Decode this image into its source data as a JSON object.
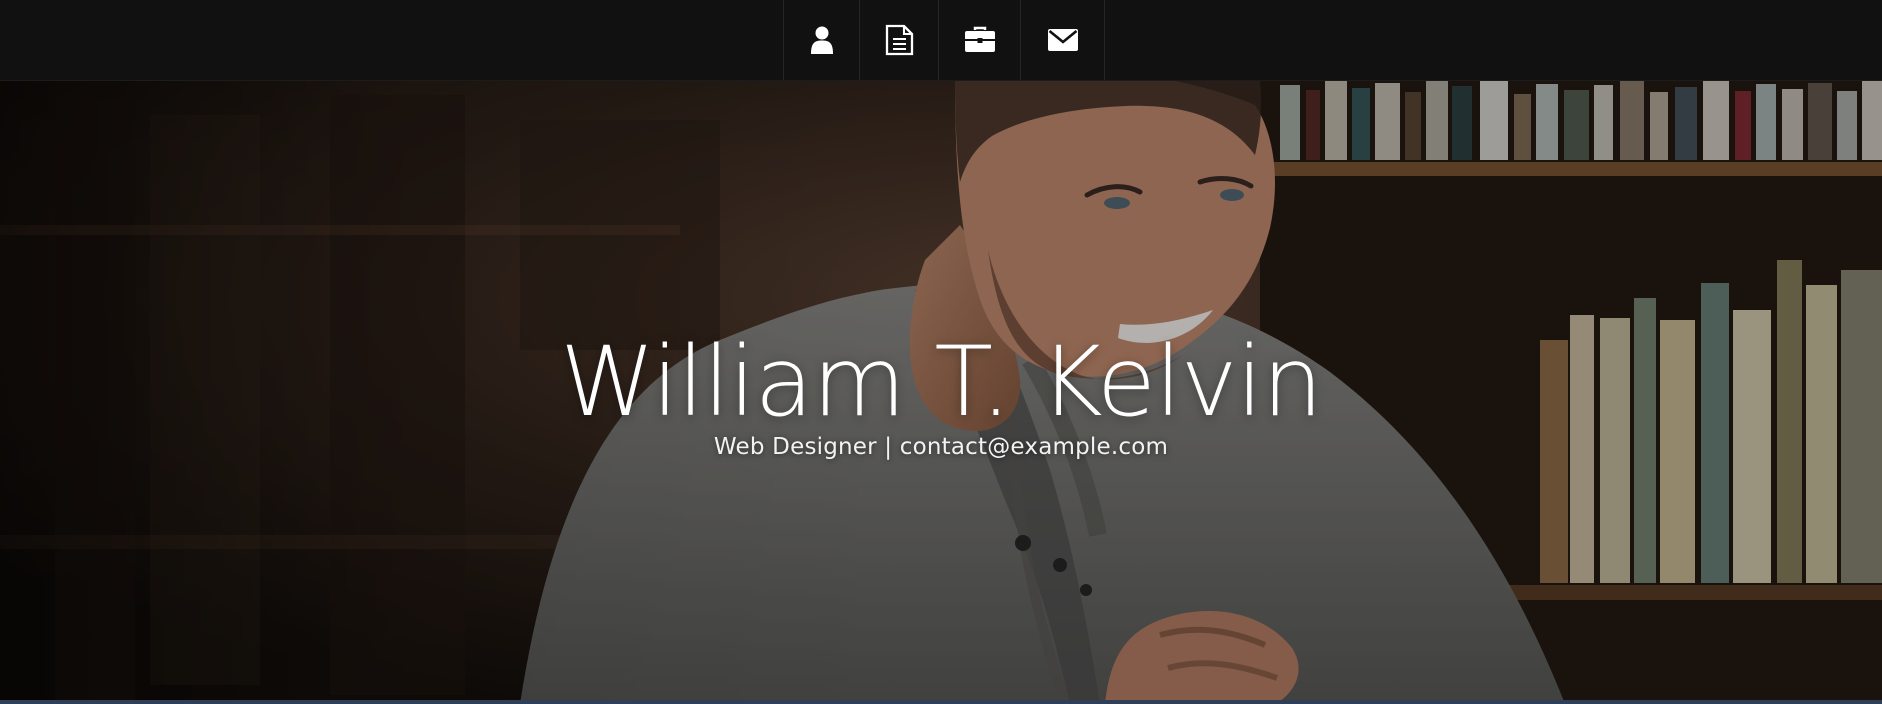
{
  "nav": {
    "items": [
      {
        "icon": "user-icon"
      },
      {
        "icon": "document-icon"
      },
      {
        "icon": "briefcase-icon"
      },
      {
        "icon": "envelope-icon"
      }
    ]
  },
  "hero": {
    "name": "William T. Kelvin",
    "subtitle": "Web Designer | contact@example.com"
  },
  "colors": {
    "topbar": "#111111",
    "text": "#ffffff"
  }
}
